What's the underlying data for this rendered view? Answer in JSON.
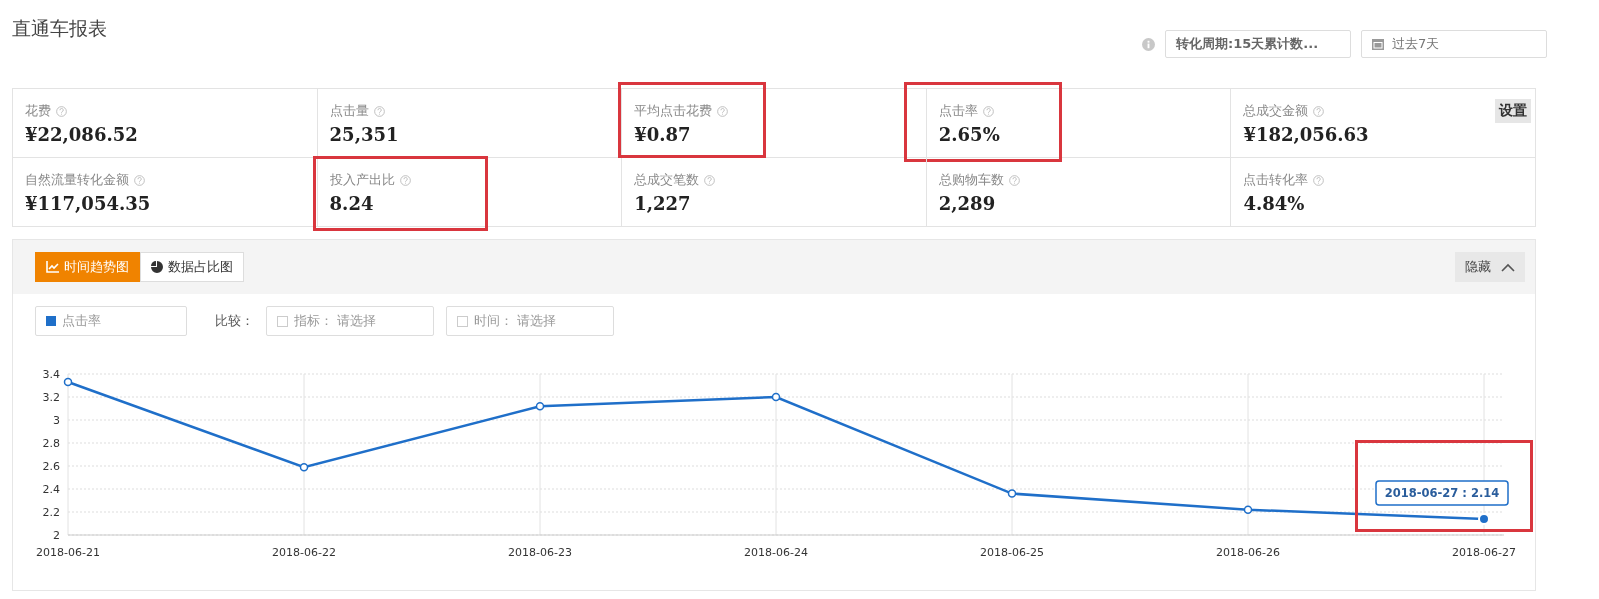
{
  "page": {
    "title": "直通车报表"
  },
  "toolbar": {
    "conversion_period": "转化周期:15天累计数...",
    "date_range": "过去7天"
  },
  "metrics": [
    {
      "label": "花费",
      "value": "¥22,086.52",
      "highlighted": false
    },
    {
      "label": "点击量",
      "value": "25,351",
      "highlighted": false
    },
    {
      "label": "平均点击花费",
      "value": "¥0.87",
      "highlighted": true
    },
    {
      "label": "点击率",
      "value": "2.65%",
      "highlighted": true
    },
    {
      "label": "总成交金额",
      "value": "¥182,056.63",
      "highlighted": false
    },
    {
      "label": "自然流量转化金额",
      "value": "¥117,054.35",
      "highlighted": false
    },
    {
      "label": "投入产出比",
      "value": "8.24",
      "highlighted": true
    },
    {
      "label": "总成交笔数",
      "value": "1,227",
      "highlighted": false
    },
    {
      "label": "总购物车数",
      "value": "2,289",
      "highlighted": false
    },
    {
      "label": "点击转化率",
      "value": "4.84%",
      "highlighted": false
    }
  ],
  "settings_button": "设置",
  "chart_panel": {
    "tabs": [
      {
        "label": "时间趋势图",
        "selected": true,
        "kind": "line"
      },
      {
        "label": "数据占比图",
        "selected": false,
        "kind": "pie"
      }
    ],
    "hide_button": "隐藏",
    "compare_label": "比较：",
    "compare_options": [
      {
        "label": "指标：",
        "placeholder": "请选择",
        "checked": false
      },
      {
        "label": "时间：",
        "placeholder": "请选择",
        "checked": false
      }
    ],
    "tooltip": {
      "text": "2018-06-27 : 2.14",
      "highlighted": true
    },
    "chart_data": {
      "type": "line",
      "grid": true,
      "categories": [
        "2018-06-21",
        "2018-06-22",
        "2018-06-23",
        "2018-06-24",
        "2018-06-25",
        "2018-06-26",
        "2018-06-27"
      ],
      "series": [
        {
          "name": "点击率",
          "color": "#1f6fc9",
          "marker": "circle",
          "values": [
            3.33,
            2.59,
            3.12,
            3.2,
            2.36,
            2.22,
            2.14
          ]
        }
      ],
      "ylim": [
        2,
        3.4
      ],
      "yticks": [
        {
          "value": 2,
          "label": "2"
        },
        {
          "value": 2.2,
          "label": "2.2"
        },
        {
          "value": 2.4,
          "label": "2.4"
        },
        {
          "value": 2.6,
          "label": "2.6"
        },
        {
          "value": 2.8,
          "label": "2.8"
        },
        {
          "value": 3,
          "label": "3"
        },
        {
          "value": 3.2,
          "label": "3.2"
        },
        {
          "value": 3.4,
          "label": "3.4"
        }
      ]
    }
  }
}
